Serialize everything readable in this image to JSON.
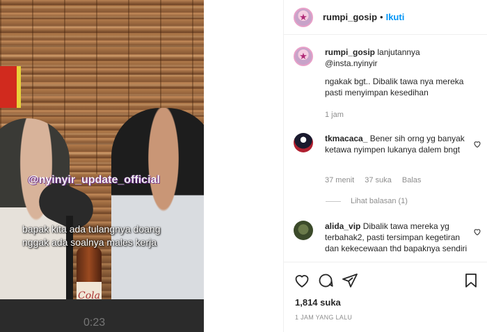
{
  "video": {
    "watermark": "@nyinyir_update_official",
    "caption": "bapak kita ada tulangnya doang nggak ada soalnya males kerja",
    "bottle_label": "Cola",
    "timecode": "0:23"
  },
  "header": {
    "username": "rumpi_gosip",
    "separator": "•",
    "follow_label": "Ikuti"
  },
  "comments": [
    {
      "username": "rumpi_gosip",
      "text": " lanjutannya @insta.nyinyir",
      "text2": "ngakak bgt.. Dibalik tawa nya mereka pasti menyimpan kesedihan",
      "time": "1 jam",
      "likes": "",
      "reply": ""
    },
    {
      "username": "tkmacaca_",
      "text": " Bener sih orng yg banyak ketawa nyimpen lukanya dalem bngt",
      "time": "37 menit",
      "likes": "37 suka",
      "reply": "Balas"
    },
    {
      "username": "alida_vip",
      "text": " Dibalik tawa mereka yg terbahak2, pasti tersimpan kegetiran dan kekecewaan thd bapaknya sendiri",
      "time": "",
      "likes": "",
      "reply": ""
    }
  ],
  "view_replies": "Lihat balasan (1)",
  "actions": {
    "likes": "1,814 suka",
    "time_ago": "1 JAM YANG LALU"
  }
}
